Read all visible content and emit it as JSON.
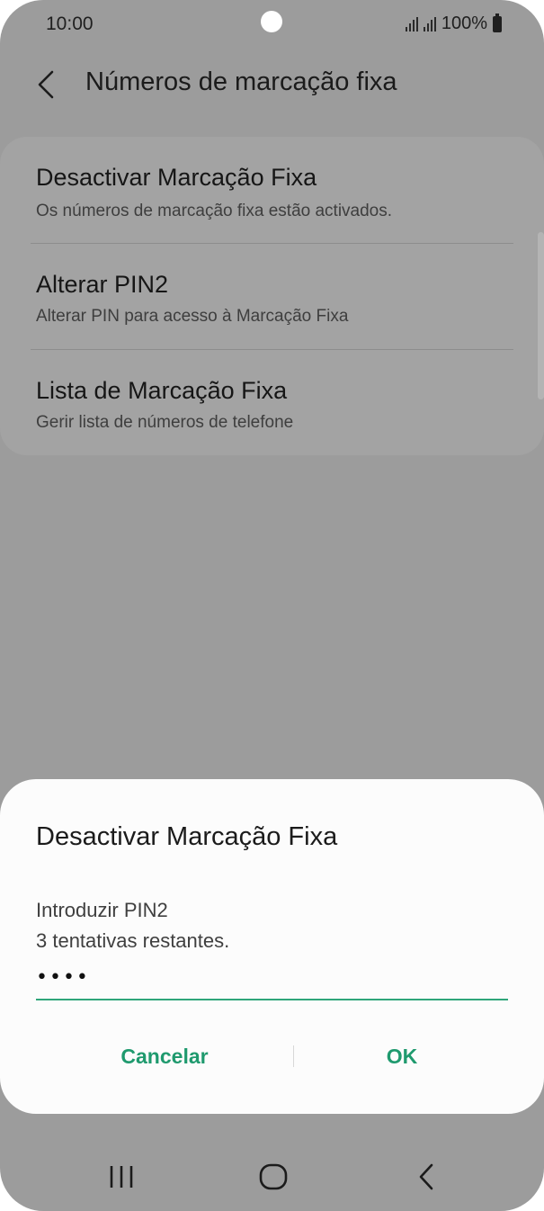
{
  "status_bar": {
    "time": "10:00",
    "battery": "100%"
  },
  "header": {
    "title": "Números de marcação fixa"
  },
  "settings": [
    {
      "title": "Desactivar Marcação Fixa",
      "subtitle": "Os números de marcação fixa estão activados."
    },
    {
      "title": "Alterar PIN2",
      "subtitle": "Alterar PIN para acesso à Marcação Fixa"
    },
    {
      "title": "Lista de Marcação Fixa",
      "subtitle": "Gerir lista de números de telefone"
    }
  ],
  "dialog": {
    "title": "Desactivar Marcação Fixa",
    "prompt": "Introduzir PIN2",
    "attempts": "3 tentativas restantes.",
    "pin_value": "••••",
    "cancel_label": "Cancelar",
    "ok_label": "OK"
  },
  "colors": {
    "accent": "#1f9a6e",
    "input_underline": "#2fa57a",
    "scrim": "#9c9c9c"
  },
  "icons": {
    "back": "chevron-left-icon",
    "nav_recents": "recents-icon",
    "nav_home": "home-icon",
    "nav_back": "back-icon"
  }
}
